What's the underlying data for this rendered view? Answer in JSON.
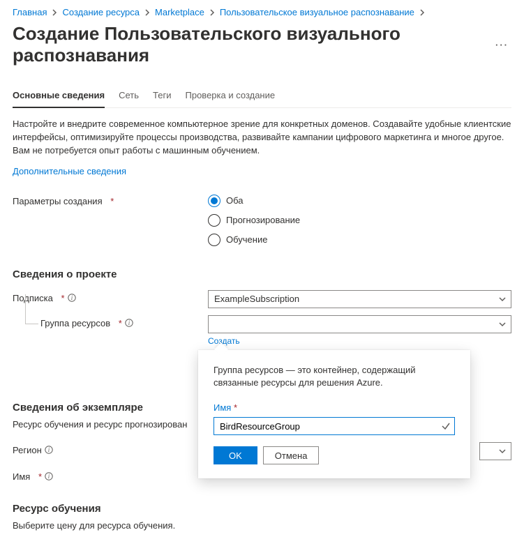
{
  "breadcrumb": {
    "items": [
      {
        "label": "Главная"
      },
      {
        "label": "Создание ресурса"
      },
      {
        "label": "Marketplace"
      },
      {
        "label": "Пользовательское визуальное распознавание"
      }
    ]
  },
  "title": "Создание Пользовательского визуального распознавания",
  "more_icon": "···",
  "tabs": {
    "items": [
      {
        "label": "Основные сведения",
        "active": true
      },
      {
        "label": "Сеть",
        "active": false
      },
      {
        "label": "Теги",
        "active": false
      },
      {
        "label": "Проверка и создание",
        "active": false
      }
    ]
  },
  "intro": "Настройте и внедрите современное компьютерное зрение для конкретных доменов. Создавайте удобные клиентские интерфейсы, оптимизируйте процессы производства, развивайте кампании цифрового маркетинга и многое другое. Вам не потребуется опыт работы с машинным обучением.",
  "more_info_link": "Дополнительные сведения",
  "creation_params": {
    "label": "Параметры создания",
    "options": [
      {
        "label": "Оба",
        "selected": true
      },
      {
        "label": "Прогнозирование",
        "selected": false
      },
      {
        "label": "Обучение",
        "selected": false
      }
    ]
  },
  "project": {
    "heading": "Сведения о проекте",
    "subscription_label": "Подписка",
    "subscription_value": "ExampleSubscription",
    "resource_group_label": "Группа ресурсов",
    "resource_group_value": "",
    "create_link": "Создать"
  },
  "callout": {
    "desc": "Группа ресурсов — это контейнер, содержащий связанные ресурсы для решения Azure.",
    "name_label": "Имя",
    "name_value": "BirdResourceGroup",
    "ok": "OK",
    "cancel": "Отмена"
  },
  "instance": {
    "heading": "Сведения об экземпляре",
    "desc": "Ресурс обучения и ресурс прогнозирован",
    "region_label": "Регион",
    "name_label": "Имя"
  },
  "training": {
    "heading": "Ресурс обучения",
    "desc": "Выберите цену для ресурса обучения."
  }
}
